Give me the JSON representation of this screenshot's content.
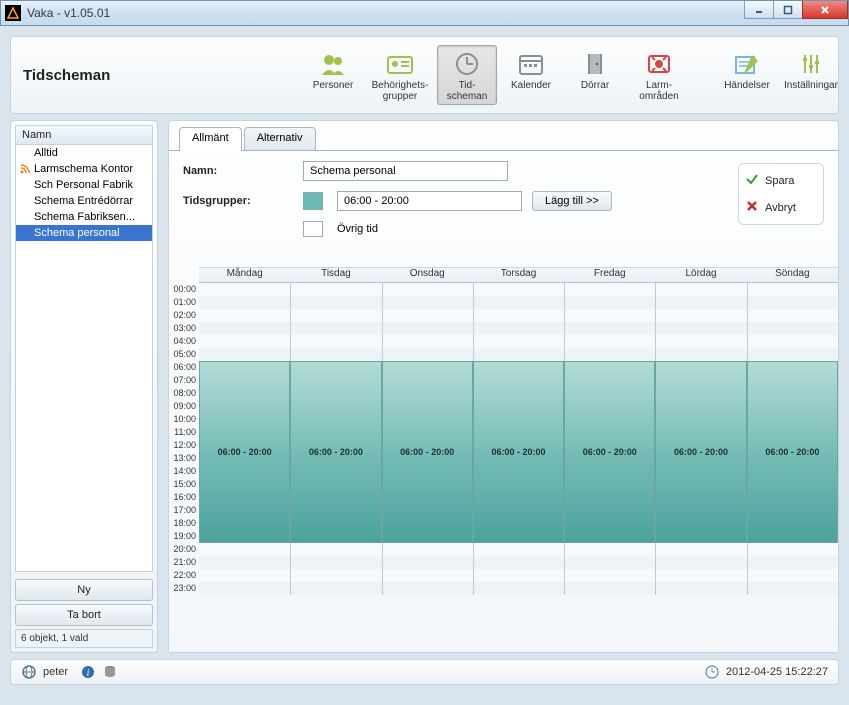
{
  "window": {
    "title": "Vaka - v1.05.01"
  },
  "header": {
    "title": "Tidscheman"
  },
  "toolbar": {
    "items": [
      {
        "label": "Personer"
      },
      {
        "label": "Behörighets-\ngrupper"
      },
      {
        "label": "Tid-\nscheman",
        "selected": true
      },
      {
        "label": "Kalender"
      },
      {
        "label": "Dörrar"
      },
      {
        "label": "Larm-\nområden"
      },
      {
        "label": "Händelser"
      },
      {
        "label": "Inställningar"
      }
    ]
  },
  "sidebar": {
    "header": "Namn",
    "items": [
      {
        "label": "Alltid"
      },
      {
        "label": "Larmschema Kontor",
        "icon": "rss"
      },
      {
        "label": "Sch Personal Fabrik"
      },
      {
        "label": "Schema Entrédörrar"
      },
      {
        "label": "Schema Fabriksen..."
      },
      {
        "label": "Schema personal",
        "selected": true
      }
    ],
    "new_btn": "Ny",
    "del_btn": "Ta bort",
    "status": "6 objekt, 1 vald"
  },
  "tabs": {
    "general": "Allmänt",
    "alt": "Alternativ"
  },
  "form": {
    "name_label": "Namn:",
    "name_value": "Schema personal",
    "tg_label": "Tidsgrupper:",
    "tg_value": "06:00 - 20:00",
    "add_btn": "Lägg till >>",
    "other_label": "Övrig tid"
  },
  "actions": {
    "save": "Spara",
    "cancel": "Avbryt"
  },
  "schedule": {
    "days": [
      "Måndag",
      "Tisdag",
      "Onsdag",
      "Torsdag",
      "Fredag",
      "Lördag",
      "Söndag"
    ],
    "hours": [
      "00:00",
      "01:00",
      "02:00",
      "03:00",
      "04:00",
      "05:00",
      "06:00",
      "07:00",
      "08:00",
      "09:00",
      "10:00",
      "11:00",
      "12:00",
      "13:00",
      "14:00",
      "15:00",
      "16:00",
      "17:00",
      "18:00",
      "19:00",
      "20:00",
      "21:00",
      "22:00",
      "23:00"
    ],
    "block_label": "06:00 - 20:00",
    "block_start_row": 6,
    "block_end_row": 20
  },
  "statusbar": {
    "user": "peter",
    "datetime": "2012-04-25 15:22:27"
  }
}
